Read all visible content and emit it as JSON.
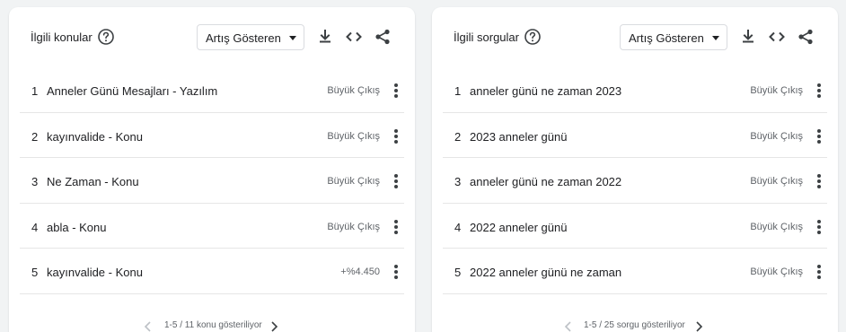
{
  "related_topics": {
    "title": "İlgili konular",
    "help_icon": "help-circle-icon",
    "dropdown_label": "Artış Gösteren",
    "tools": [
      "download-icon",
      "embed-code-icon",
      "share-icon"
    ],
    "rows": [
      {
        "rank": "1",
        "label": "Anneler Günü Mesajları - Yazılım",
        "value": "Büyük Çıkış"
      },
      {
        "rank": "2",
        "label": "kayınvalide - Konu",
        "value": "Büyük Çıkış"
      },
      {
        "rank": "3",
        "label": "Ne Zaman - Konu",
        "value": "Büyük Çıkış"
      },
      {
        "rank": "4",
        "label": "abla - Konu",
        "value": "Büyük Çıkış"
      },
      {
        "rank": "5",
        "label": "kayınvalide - Konu",
        "value": "+%4.450"
      }
    ],
    "pager_text": "1-5 / 11 konu gösteriliyor"
  },
  "related_queries": {
    "title": "İlgili sorgular",
    "help_icon": "help-circle-icon",
    "dropdown_label": "Artış Gösteren",
    "tools": [
      "download-icon",
      "embed-code-icon",
      "share-icon"
    ],
    "rows": [
      {
        "rank": "1",
        "label": "anneler günü ne zaman 2023",
        "value": "Büyük Çıkış"
      },
      {
        "rank": "2",
        "label": "2023 anneler günü",
        "value": "Büyük Çıkış"
      },
      {
        "rank": "3",
        "label": "anneler günü ne zaman 2022",
        "value": "Büyük Çıkış"
      },
      {
        "rank": "4",
        "label": "2022 anneler günü",
        "value": "Büyük Çıkış"
      },
      {
        "rank": "5",
        "label": "2022 anneler günü ne zaman",
        "value": "Büyük Çıkış"
      }
    ],
    "pager_text": "1-5 / 25 sorgu gösteriliyor"
  },
  "colors": {
    "background": "#f1f3f4",
    "card": "#ffffff",
    "icon": "#3c4043",
    "muted_text": "#5f6368",
    "divider": "#e6e6e6"
  }
}
